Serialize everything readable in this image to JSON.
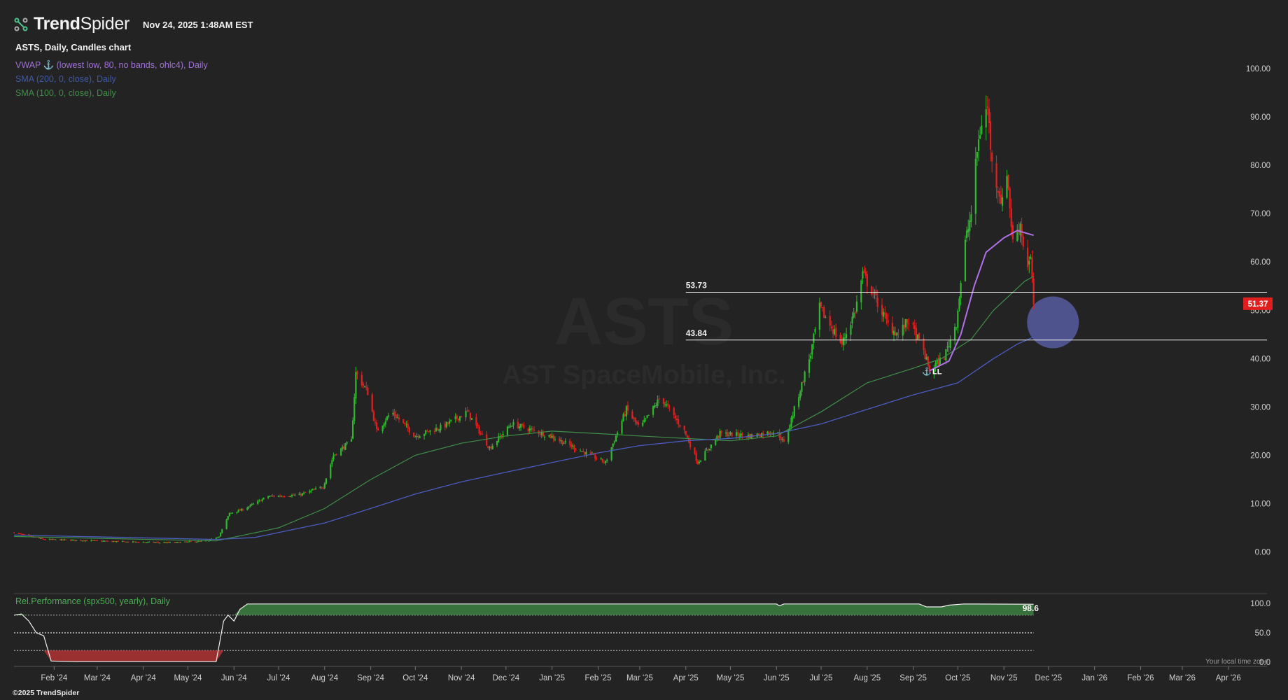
{
  "app": {
    "brand_trend": "Trend",
    "brand_spider": "Spider",
    "timestamp": "Nov 24, 2025 1:48AM EST",
    "copyright": "©2025 TrendSpider",
    "local_time_note": "Your local time zone"
  },
  "header": {
    "symbol_title": "ASTS, Daily, Candles chart",
    "indicators": {
      "vwap": "VWAP ⚓ (lowest low, 80, no bands, ohlc4), Daily",
      "sma200": "SMA (200, 0, close), Daily",
      "sma100": "SMA (100, 0, close), Daily"
    }
  },
  "watermark": {
    "ticker": "ASTS",
    "company": "AST SpaceMobile, Inc."
  },
  "colors": {
    "up": "#2fb82f",
    "down": "#e02020",
    "vwap": "#b070e8",
    "sma100": "#3f8f48",
    "sma200": "#4a5cc0",
    "last_price_bg": "#e01e1e",
    "zone": "#5a5fa8"
  },
  "chart_data": {
    "type": "candlestick",
    "title": "ASTS, Daily, Candles chart",
    "x_labels": [
      "Feb '24",
      "Mar '24",
      "Apr '24",
      "May '24",
      "Jun '24",
      "Jul '24",
      "Aug '24",
      "Sep '24",
      "Oct '24",
      "Nov '24",
      "Dec '24",
      "Jan '25",
      "Feb '25",
      "Mar '25",
      "Apr '25",
      "May '25",
      "Jun '25",
      "Jul '25",
      "Aug '25",
      "Sep '25",
      "Oct '25",
      "Nov '25",
      "Dec '25",
      "Jan '26",
      "Feb '26",
      "Mar '26",
      "Apr '26"
    ],
    "x_range": [
      "2024-01-05",
      "2026-04-27"
    ],
    "y_ticks": [
      "100.00",
      "90.00",
      "80.00",
      "70.00",
      "60.00",
      "50.00",
      "40.00",
      "30.00",
      "20.00",
      "10.00",
      "0.00"
    ],
    "ylim": [
      -0.5,
      100
    ],
    "last_price": "51.37",
    "horizontal_levels": [
      {
        "label": "53.73",
        "value": 53.73,
        "start": "2025-04-01"
      },
      {
        "label": "43.84",
        "value": 43.84,
        "start": "2025-04-01"
      }
    ],
    "price_path": [
      [
        "2024-01-05",
        4.0
      ],
      [
        "2024-01-25",
        2.6
      ],
      [
        "2024-02-20",
        2.4
      ],
      [
        "2024-03-20",
        2.1
      ],
      [
        "2024-04-20",
        1.9
      ],
      [
        "2024-05-15",
        2.3
      ],
      [
        "2024-05-22",
        3.3
      ],
      [
        "2024-05-29",
        8.0
      ],
      [
        "2024-06-07",
        8.8
      ],
      [
        "2024-06-24",
        11.5
      ],
      [
        "2024-07-15",
        11.8
      ],
      [
        "2024-07-31",
        13.5
      ],
      [
        "2024-08-07",
        20.0
      ],
      [
        "2024-08-19",
        23.0
      ],
      [
        "2024-08-22",
        37.0
      ],
      [
        "2024-08-30",
        33.0
      ],
      [
        "2024-09-05",
        25.0
      ],
      [
        "2024-09-15",
        29.0
      ],
      [
        "2024-10-01",
        24.0
      ],
      [
        "2024-10-20",
        26.0
      ],
      [
        "2024-11-05",
        29.0
      ],
      [
        "2024-11-20",
        21.5
      ],
      [
        "2024-12-05",
        26.5
      ],
      [
        "2024-12-31",
        24.0
      ],
      [
        "2025-01-20",
        21.0
      ],
      [
        "2025-02-06",
        18.5
      ],
      [
        "2025-02-20",
        29.5
      ],
      [
        "2025-03-01",
        25.5
      ],
      [
        "2025-03-15",
        32.0
      ],
      [
        "2025-03-31",
        25.0
      ],
      [
        "2025-04-09",
        18.5
      ],
      [
        "2025-04-24",
        24.5
      ],
      [
        "2025-05-15",
        24.0
      ],
      [
        "2025-06-01",
        25.0
      ],
      [
        "2025-06-06",
        22.5
      ],
      [
        "2025-06-15",
        31.5
      ],
      [
        "2025-06-24",
        41.0
      ],
      [
        "2025-06-30",
        50.5
      ],
      [
        "2025-07-05",
        48.0
      ],
      [
        "2025-07-15",
        43.0
      ],
      [
        "2025-07-24",
        50.0
      ],
      [
        "2025-07-29",
        57.5
      ],
      [
        "2025-08-05",
        53.5
      ],
      [
        "2025-08-15",
        47.0
      ],
      [
        "2025-08-22",
        45.0
      ],
      [
        "2025-08-29",
        48.0
      ],
      [
        "2025-09-08",
        41.5
      ],
      [
        "2025-09-12",
        37.5
      ],
      [
        "2025-09-22",
        40.5
      ],
      [
        "2025-09-30",
        47.5
      ],
      [
        "2025-10-06",
        64.0
      ],
      [
        "2025-10-10",
        70.0
      ],
      [
        "2025-10-14",
        83.0
      ],
      [
        "2025-10-17",
        89.0
      ],
      [
        "2025-10-21",
        92.0
      ],
      [
        "2025-10-24",
        80.0
      ],
      [
        "2025-10-31",
        72.0
      ],
      [
        "2025-11-03",
        79.0
      ],
      [
        "2025-11-07",
        64.0
      ],
      [
        "2025-11-12",
        68.0
      ],
      [
        "2025-11-16",
        59.0
      ],
      [
        "2025-11-19",
        60.5
      ],
      [
        "2025-11-21",
        51.37
      ]
    ],
    "series": [
      {
        "name": "SMA (100, 0, close), Daily",
        "start": "2024-01-05",
        "end": "2025-10-10",
        "points": [
          [
            "2024-01-05",
            3.2
          ],
          [
            "2024-05-20",
            2.3
          ],
          [
            "2024-07-01",
            5.0
          ],
          [
            "2024-08-01",
            9.0
          ],
          [
            "2024-09-01",
            15.0
          ],
          [
            "2024-10-01",
            20.0
          ],
          [
            "2024-11-01",
            22.5
          ],
          [
            "2024-12-01",
            24.0
          ],
          [
            "2025-01-01",
            25.0
          ],
          [
            "2025-02-01",
            24.5
          ],
          [
            "2025-03-01",
            24.0
          ],
          [
            "2025-04-01",
            23.5
          ],
          [
            "2025-05-01",
            23.0
          ],
          [
            "2025-06-01",
            24.0
          ],
          [
            "2025-07-01",
            29.0
          ],
          [
            "2025-08-01",
            35.0
          ],
          [
            "2025-09-01",
            38.0
          ],
          [
            "2025-09-20",
            40.0
          ],
          [
            "2025-10-10",
            44.0
          ],
          [
            "2025-10-25",
            50.0
          ],
          [
            "2025-11-15",
            56.0
          ],
          [
            "2025-11-21",
            57.0
          ]
        ]
      },
      {
        "name": "SMA (200, 0, close), Daily",
        "points": [
          [
            "2024-01-05",
            3.5
          ],
          [
            "2024-05-20",
            2.6
          ],
          [
            "2024-06-15",
            3.0
          ],
          [
            "2024-08-01",
            6.0
          ],
          [
            "2024-09-01",
            9.0
          ],
          [
            "2024-10-01",
            12.0
          ],
          [
            "2024-11-01",
            14.5
          ],
          [
            "2024-12-01",
            16.5
          ],
          [
            "2025-01-01",
            18.5
          ],
          [
            "2025-02-01",
            20.5
          ],
          [
            "2025-03-01",
            22.0
          ],
          [
            "2025-04-01",
            23.0
          ],
          [
            "2025-05-01",
            23.5
          ],
          [
            "2025-06-01",
            24.5
          ],
          [
            "2025-07-01",
            26.5
          ],
          [
            "2025-08-01",
            29.5
          ],
          [
            "2025-09-01",
            32.5
          ],
          [
            "2025-10-01",
            35.0
          ],
          [
            "2025-10-25",
            40.0
          ],
          [
            "2025-11-10",
            43.0
          ],
          [
            "2025-11-21",
            44.5
          ]
        ]
      },
      {
        "name": "VWAP ⚓ (lowest low, 80, no bands, ohlc4), Daily",
        "points": [
          [
            "2025-09-12",
            37.5
          ],
          [
            "2025-09-25",
            39.5
          ],
          [
            "2025-10-03",
            45.0
          ],
          [
            "2025-10-12",
            55.0
          ],
          [
            "2025-10-20",
            62.0
          ],
          [
            "2025-11-01",
            65.0
          ],
          [
            "2025-11-10",
            66.5
          ],
          [
            "2025-11-21",
            65.5
          ]
        ]
      }
    ],
    "annotations": [
      {
        "text": "LL",
        "date": "2025-09-12",
        "value": 37.5
      }
    ],
    "zone": {
      "date": "2025-12-04",
      "value": 47.5
    },
    "sub_panel": {
      "label": "Rel.Performance (spx500, yearly), Daily",
      "y_ticks": [
        "100.0",
        "50.0",
        "0.0"
      ],
      "ylim": [
        0,
        100
      ],
      "last_value": "98.6",
      "dotted_levels": [
        80,
        20
      ],
      "middle_level": 50,
      "points": [
        [
          "2024-01-05",
          80.0
        ],
        [
          "2024-01-10",
          82.0
        ],
        [
          "2024-01-15",
          70.0
        ],
        [
          "2024-01-20",
          50.0
        ],
        [
          "2024-01-25",
          45.0
        ],
        [
          "2024-01-30",
          2.0
        ],
        [
          "2024-02-15",
          1.0
        ],
        [
          "2024-04-01",
          1.0
        ],
        [
          "2024-05-20",
          1.0
        ],
        [
          "2024-05-25",
          70.0
        ],
        [
          "2024-05-28",
          80.0
        ],
        [
          "2024-06-01",
          70.0
        ],
        [
          "2024-06-05",
          90.0
        ],
        [
          "2024-06-10",
          99.0
        ],
        [
          "2025-06-01",
          99.0
        ],
        [
          "2025-06-03",
          96.0
        ],
        [
          "2025-06-06",
          99.0
        ],
        [
          "2025-09-05",
          99.0
        ],
        [
          "2025-09-10",
          94.0
        ],
        [
          "2025-09-20",
          94.0
        ],
        [
          "2025-09-25",
          97.0
        ],
        [
          "2025-10-05",
          99.0
        ],
        [
          "2025-11-21",
          98.6
        ]
      ]
    }
  }
}
